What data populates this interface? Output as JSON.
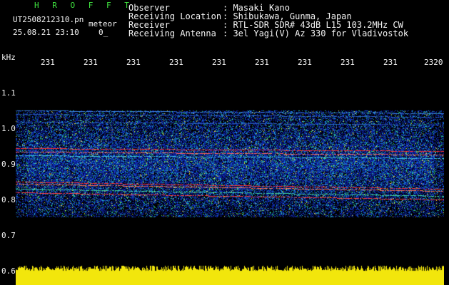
{
  "header": {
    "app_name": "H R O F F T",
    "filename": "UT2508212310.pn",
    "mode": "meteor",
    "datetime": "25.08.21 23:10",
    "counter": "0_"
  },
  "info": {
    "labels": [
      "Observer",
      "Receiving Location",
      "Receiver",
      "Receiving Antenna"
    ],
    "values": [
      ": Masaki Kano",
      ": Shibukawa, Gunma, Japan",
      ": RTL-SDR SDR# 43dB L15 103.2MHz CW",
      ": 3el Yagi(V) Az 330 for Vladivostok"
    ]
  },
  "time_axis": {
    "ticks": [
      "231",
      "231",
      "231",
      "231",
      "231",
      "231",
      "231",
      "231",
      "231",
      "2320"
    ]
  },
  "freq_axis": {
    "unit": "kHz",
    "ticks": [
      "1.1",
      "1.0",
      "0.9",
      "0.8",
      "0.7",
      "0.6"
    ]
  },
  "colors": {
    "header_green": "#3fe23f",
    "label_white": "#f4f4f4",
    "tick_yellow": "#f2e60c",
    "noise_bar": "#f2e60c",
    "signal_red": "#ff3030"
  }
}
